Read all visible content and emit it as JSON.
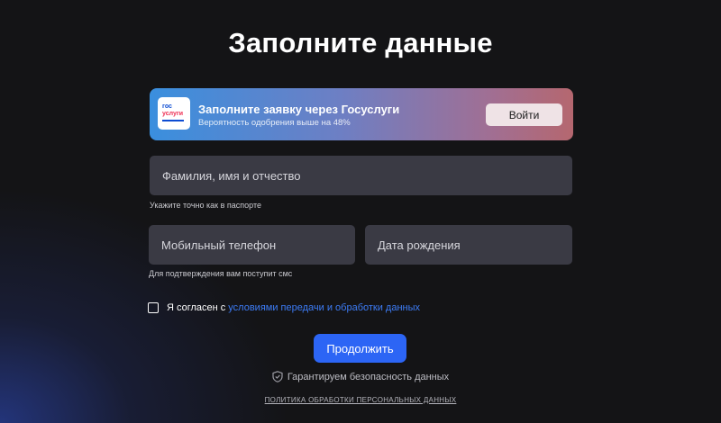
{
  "page": {
    "title": "Заполните данные"
  },
  "gosuslugi_banner": {
    "logo_line1": "гос",
    "logo_line2": "услуги",
    "title": "Заполните заявку через Госуслуги",
    "subtitle": "Вероятность одобрения выше на 48%",
    "login_label": "Войти"
  },
  "form": {
    "full_name": {
      "placeholder": "Фамилия, имя и отчество",
      "value": "",
      "hint": "Укажите точно как в паспорте"
    },
    "phone": {
      "placeholder": "Мобильный телефон",
      "value": "",
      "hint": "Для подтверждения вам поступит смс"
    },
    "birth_date": {
      "placeholder": "Дата рождения",
      "value": ""
    },
    "consent": {
      "checked": false,
      "text": "Я согласен с",
      "link_text": "условиями передачи и обработки данных"
    },
    "submit_label": "Продолжить"
  },
  "footer": {
    "security_text": "Гарантируем безопасность данных",
    "security_icon": "shield-check-icon",
    "policy_link": "ПОЛИТИКА ОБРАБОТКИ ПЕРСОНАЛЬНЫХ ДАННЫХ"
  },
  "colors": {
    "background": "#141416",
    "field_background": "#3a3a44",
    "accent": "#2c65f5",
    "link": "#3d7cf6",
    "banner_gradient_start": "#3a8fde",
    "banner_gradient_end": "#b5676f"
  }
}
